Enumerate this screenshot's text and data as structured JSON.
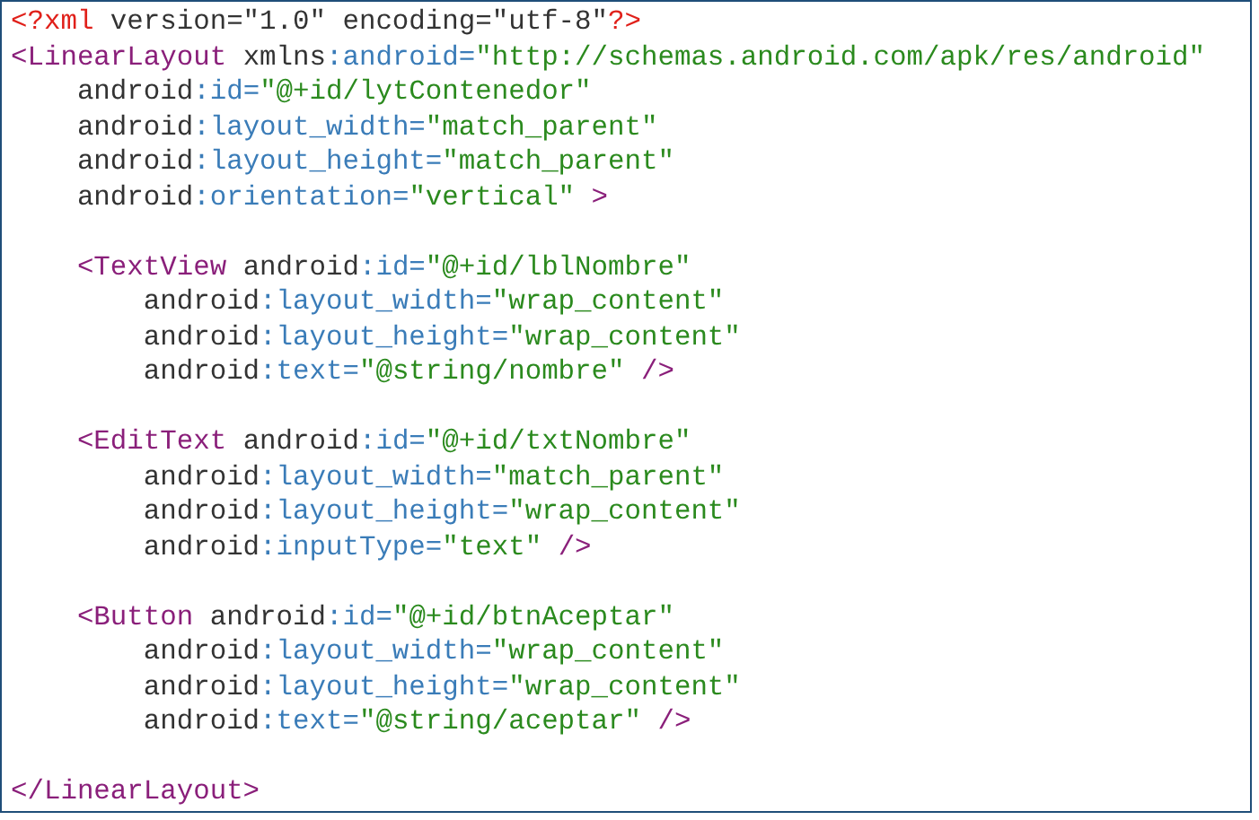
{
  "code_lines": [
    {
      "kind": "code",
      "tokens": [
        {
          "kind": "pi",
          "text": "<?xml"
        },
        {
          "kind": "plain",
          "text": " version=\"1.0\" encoding=\"utf-8\""
        },
        {
          "kind": "pi",
          "text": "?>"
        }
      ]
    },
    {
      "kind": "code",
      "tokens": [
        {
          "kind": "tag",
          "text": "<LinearLayout"
        },
        {
          "kind": "plain",
          "text": " xmlns"
        },
        {
          "kind": "attr",
          "text": ":android="
        },
        {
          "kind": "string",
          "text": "\"http://schemas.android.com/apk/res/android\""
        }
      ]
    },
    {
      "kind": "code",
      "tokens": [
        {
          "kind": "plain",
          "text": "    android"
        },
        {
          "kind": "attr",
          "text": ":id="
        },
        {
          "kind": "string",
          "text": "\"@+id/lytContenedor\""
        }
      ]
    },
    {
      "kind": "code",
      "tokens": [
        {
          "kind": "plain",
          "text": "    android"
        },
        {
          "kind": "attr",
          "text": ":layout_width="
        },
        {
          "kind": "string",
          "text": "\"match_parent\""
        }
      ]
    },
    {
      "kind": "code",
      "tokens": [
        {
          "kind": "plain",
          "text": "    android"
        },
        {
          "kind": "attr",
          "text": ":layout_height="
        },
        {
          "kind": "string",
          "text": "\"match_parent\""
        }
      ]
    },
    {
      "kind": "code",
      "tokens": [
        {
          "kind": "plain",
          "text": "    android"
        },
        {
          "kind": "attr",
          "text": ":orientation="
        },
        {
          "kind": "string",
          "text": "\"vertical\""
        },
        {
          "kind": "tag",
          "text": " >"
        }
      ]
    },
    {
      "kind": "blank"
    },
    {
      "kind": "code",
      "tokens": [
        {
          "kind": "tag",
          "text": "    <TextView"
        },
        {
          "kind": "plain",
          "text": " android"
        },
        {
          "kind": "attr",
          "text": ":id="
        },
        {
          "kind": "string",
          "text": "\"@+id/lblNombre\""
        }
      ]
    },
    {
      "kind": "code",
      "tokens": [
        {
          "kind": "plain",
          "text": "        android"
        },
        {
          "kind": "attr",
          "text": ":layout_width="
        },
        {
          "kind": "string",
          "text": "\"wrap_content\""
        }
      ]
    },
    {
      "kind": "code",
      "tokens": [
        {
          "kind": "plain",
          "text": "        android"
        },
        {
          "kind": "attr",
          "text": ":layout_height="
        },
        {
          "kind": "string",
          "text": "\"wrap_content\""
        }
      ]
    },
    {
      "kind": "code",
      "tokens": [
        {
          "kind": "plain",
          "text": "        android"
        },
        {
          "kind": "attr",
          "text": ":text="
        },
        {
          "kind": "string",
          "text": "\"@string/nombre\""
        },
        {
          "kind": "tag",
          "text": " />"
        }
      ]
    },
    {
      "kind": "blank"
    },
    {
      "kind": "code",
      "tokens": [
        {
          "kind": "tag",
          "text": "    <EditText"
        },
        {
          "kind": "plain",
          "text": " android"
        },
        {
          "kind": "attr",
          "text": ":id="
        },
        {
          "kind": "string",
          "text": "\"@+id/txtNombre\""
        }
      ]
    },
    {
      "kind": "code",
      "tokens": [
        {
          "kind": "plain",
          "text": "        android"
        },
        {
          "kind": "attr",
          "text": ":layout_width="
        },
        {
          "kind": "string",
          "text": "\"match_parent\""
        }
      ]
    },
    {
      "kind": "code",
      "tokens": [
        {
          "kind": "plain",
          "text": "        android"
        },
        {
          "kind": "attr",
          "text": ":layout_height="
        },
        {
          "kind": "string",
          "text": "\"wrap_content\""
        }
      ]
    },
    {
      "kind": "code",
      "tokens": [
        {
          "kind": "plain",
          "text": "        android"
        },
        {
          "kind": "attr",
          "text": ":inputType="
        },
        {
          "kind": "string",
          "text": "\"text\""
        },
        {
          "kind": "tag",
          "text": " />"
        }
      ]
    },
    {
      "kind": "blank"
    },
    {
      "kind": "code",
      "tokens": [
        {
          "kind": "tag",
          "text": "    <Button"
        },
        {
          "kind": "plain",
          "text": " android"
        },
        {
          "kind": "attr",
          "text": ":id="
        },
        {
          "kind": "string",
          "text": "\"@+id/btnAceptar\""
        }
      ]
    },
    {
      "kind": "code",
      "tokens": [
        {
          "kind": "plain",
          "text": "        android"
        },
        {
          "kind": "attr",
          "text": ":layout_width="
        },
        {
          "kind": "string",
          "text": "\"wrap_content\""
        }
      ]
    },
    {
      "kind": "code",
      "tokens": [
        {
          "kind": "plain",
          "text": "        android"
        },
        {
          "kind": "attr",
          "text": ":layout_height="
        },
        {
          "kind": "string",
          "text": "\"wrap_content\""
        }
      ]
    },
    {
      "kind": "code",
      "tokens": [
        {
          "kind": "plain",
          "text": "        android"
        },
        {
          "kind": "attr",
          "text": ":text="
        },
        {
          "kind": "string",
          "text": "\"@string/aceptar\""
        },
        {
          "kind": "tag",
          "text": " />"
        }
      ]
    },
    {
      "kind": "blank"
    },
    {
      "kind": "code",
      "tokens": [
        {
          "kind": "tag",
          "text": "</LinearLayout>"
        }
      ]
    }
  ]
}
